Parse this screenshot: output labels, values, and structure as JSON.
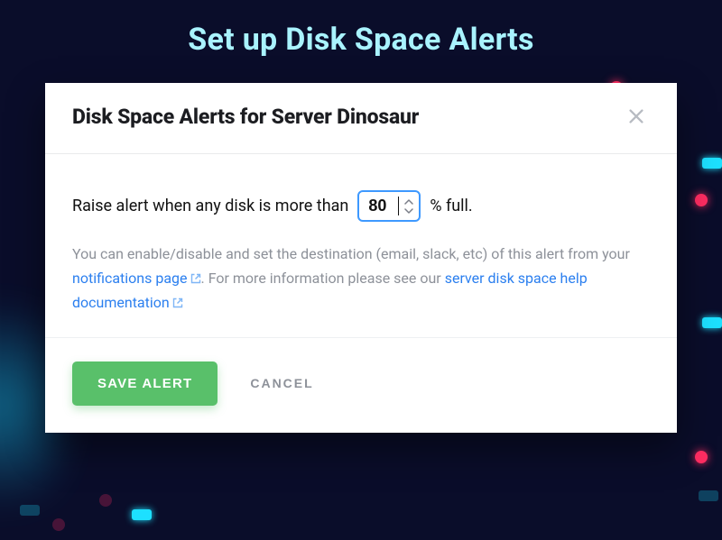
{
  "page": {
    "title": "Set up Disk Space Alerts"
  },
  "modal": {
    "title": "Disk Space Alerts for Server Dinosaur",
    "threshold": {
      "prefix": "Raise alert when any disk is more than",
      "value": "80",
      "suffix": "% full."
    },
    "help": {
      "part1": "You can enable/disable and set the destination (email, slack, etc) of this alert from your ",
      "link1": "notifications page",
      "part2": ". For more information please see our ",
      "link2": "server disk space help documentation"
    },
    "buttons": {
      "save": "SAVE ALERT",
      "cancel": "CANCEL"
    }
  },
  "colors": {
    "accent_cyan": "#a9f3ff",
    "link_blue": "#2b7fef",
    "primary_green": "#59c06a",
    "bg_navy": "#0a0d2a"
  }
}
